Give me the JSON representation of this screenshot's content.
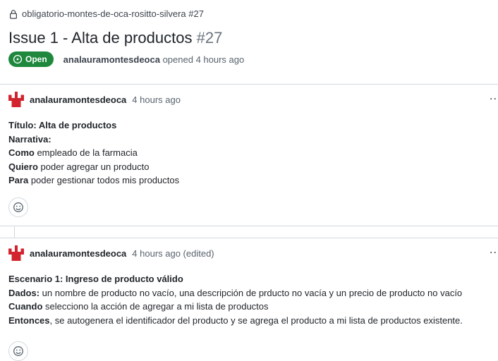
{
  "repo": {
    "name": "obligatorio-montes-de-oca-rositto-silvera #27"
  },
  "issue": {
    "title": "Issue 1 - Alta de productos",
    "number": "#27",
    "status": "Open",
    "author": "analauramontesdeoca",
    "opened_text": "opened 4 hours ago"
  },
  "comments": [
    {
      "author": "analauramontesdeoca",
      "time": "4 hours ago",
      "menu": "...",
      "lines": [
        {
          "bold": "Título: Alta de productos",
          "text": ""
        },
        {
          "bold": "Narrativa:",
          "text": ""
        },
        {
          "bold": "Como",
          "text": " empleado de la farmacia"
        },
        {
          "bold": "Quiero",
          "text": " poder agregar un producto"
        },
        {
          "bold": "Para",
          "text": " poder gestionar todos mis productos"
        }
      ]
    },
    {
      "author": "analauramontesdeoca",
      "time": "4 hours ago (edited)",
      "menu": "...",
      "lines": [
        {
          "bold": "Escenario 1: Ingreso de producto válido",
          "text": ""
        },
        {
          "bold": "Dados:",
          "text": " un nombre de producto no vacío, una descripción de prducto no vacía y un precio de producto no vacío"
        },
        {
          "bold": "Cuando",
          "text": " selecciono la acción de agregar a mi lista de productos"
        },
        {
          "bold": "Entonces",
          "text": ", se autogenera el identificador del producto y se agrega el producto a mi lista de productos existente."
        }
      ]
    }
  ],
  "icons": {
    "repo_lock": "lock-icon",
    "status": "issue-open-icon",
    "reaction": "smiley-icon",
    "avatar": "identicon-avatar"
  },
  "colors": {
    "open_badge": "#1f883d",
    "avatar": "#d1242f"
  }
}
